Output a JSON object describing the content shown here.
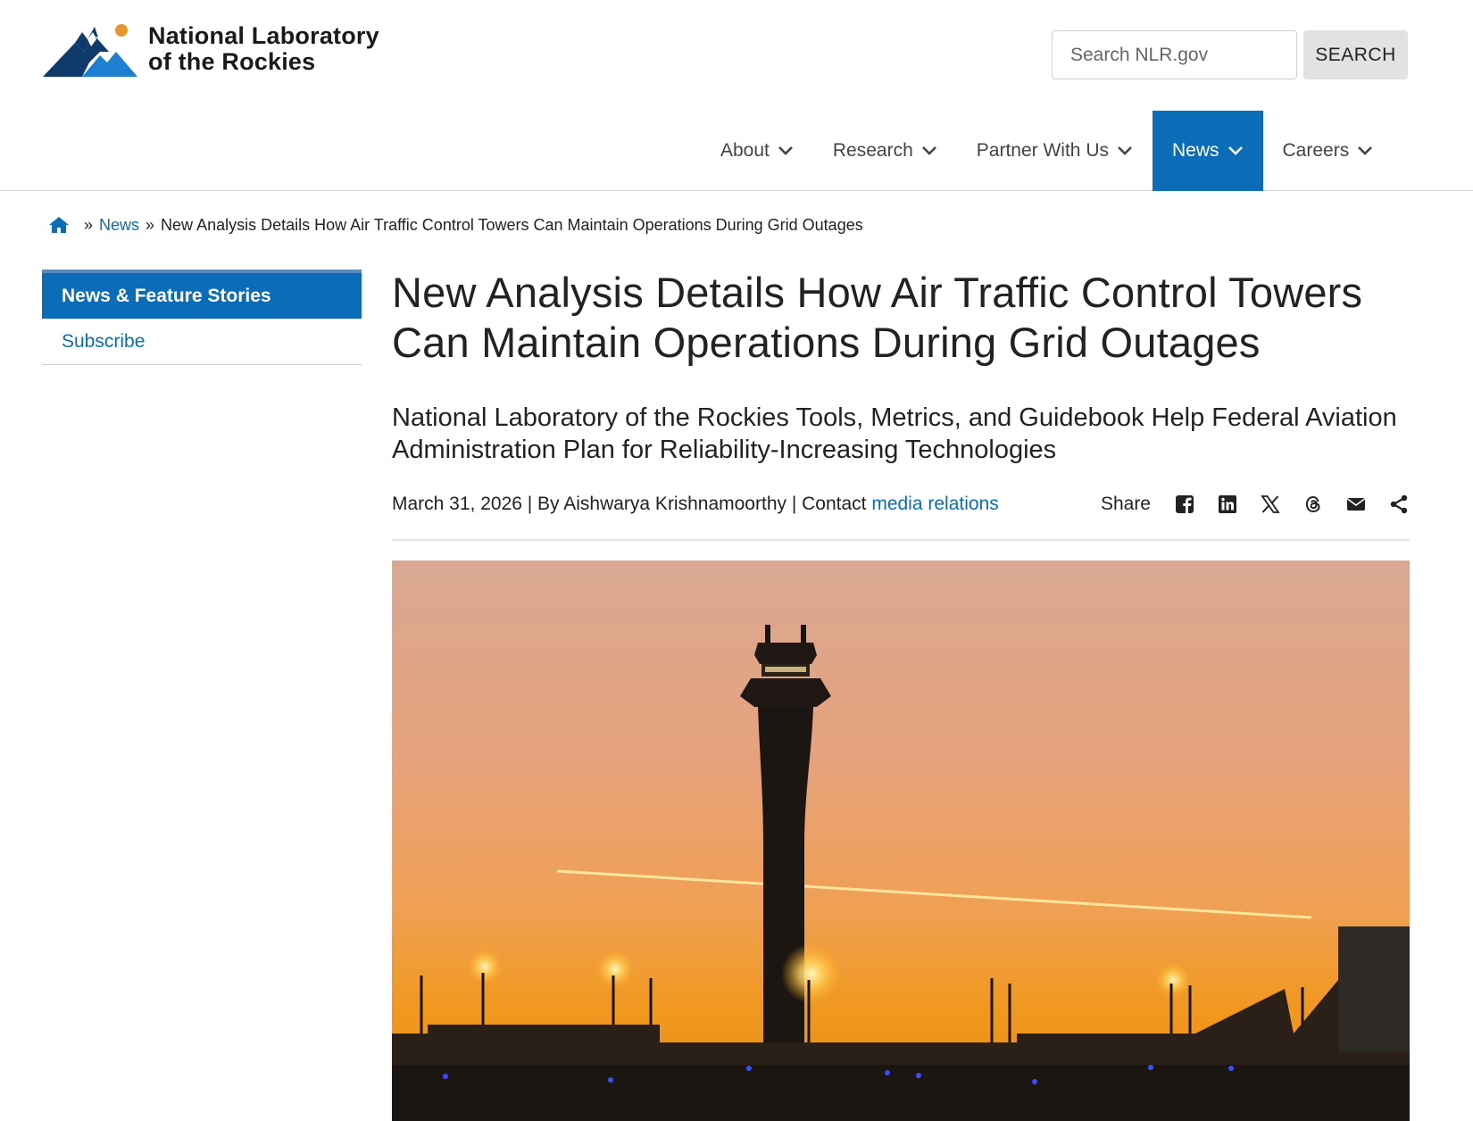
{
  "site": {
    "logo_line1": "National Laboratory",
    "logo_line2": "of the Rockies",
    "colors": {
      "brand_blue": "#0b6cb8",
      "logo_dark": "#0f3b6c",
      "logo_light": "#1d7fcf",
      "logo_sun": "#e8962a"
    }
  },
  "search": {
    "placeholder": "Search NLR.gov",
    "button_label": "SEARCH"
  },
  "nav": {
    "items": [
      {
        "label": "About"
      },
      {
        "label": "Research"
      },
      {
        "label": "Partner With Us"
      },
      {
        "label": "News",
        "active": true
      },
      {
        "label": "Careers"
      }
    ]
  },
  "breadcrumb": {
    "home_icon": "home-icon",
    "news": "News",
    "current": "New Analysis Details How Air Traffic Control Towers Can Maintain Operations During Grid Outages"
  },
  "sidebar": {
    "active": "News & Feature Stories",
    "link": "Subscribe"
  },
  "article": {
    "title": "New Analysis Details How Air Traffic Control Towers Can Maintain Operations During Grid Outages",
    "subtitle": "National Laboratory of the Rockies Tools, Metrics, and Guidebook Help Federal Aviation Administration Plan for Reliability-Increasing Technologies",
    "byline_prefix": "March 31, 2026 | By Aishwarya Krishnamoorthy | Contact ",
    "contact_link": "media relations",
    "share_label": "Share",
    "share_icons": [
      "facebook-icon",
      "linkedin-icon",
      "x-icon",
      "threads-icon",
      "email-icon",
      "share-icon"
    ],
    "hero_image": "air-traffic-control-tower-at-sunset"
  }
}
